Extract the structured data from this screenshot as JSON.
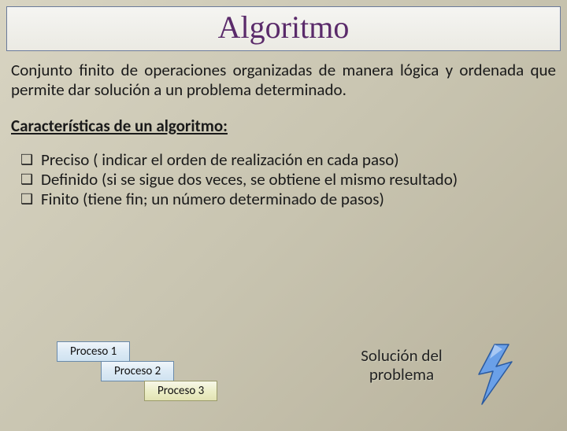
{
  "title": "Algoritmo",
  "definition": "Conjunto finito de operaciones organizadas de manera lógica y ordenada que permite dar solución a un problema determinado.",
  "subtitle": "Características de un algoritmo:",
  "bullets": [
    "Preciso ( indicar el orden de realización en cada paso)",
    "Definido (si se sigue dos veces, se obtiene el mismo resultado)",
    "Finito (tiene fin; un número determinado de pasos)"
  ],
  "process": {
    "step1": "Proceso 1",
    "step2": "Proceso 2",
    "step3": "Proceso 3"
  },
  "solution_line1": "Solución del",
  "solution_line2": "problema"
}
